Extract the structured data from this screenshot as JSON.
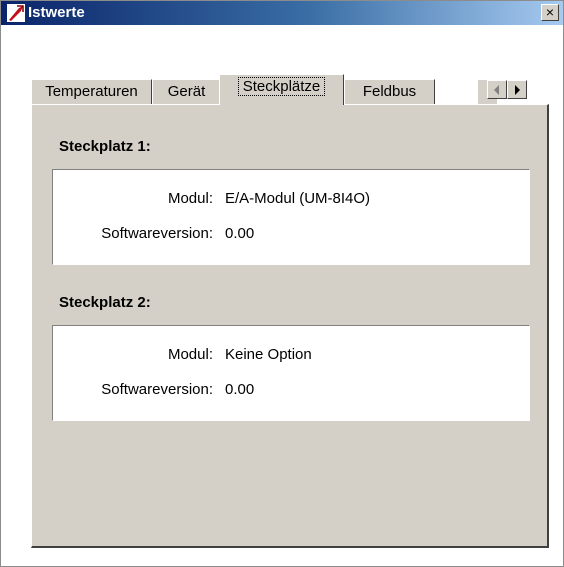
{
  "window": {
    "title": "Istwerte",
    "close_label": "×"
  },
  "tabs": [
    {
      "label": "Temperaturen",
      "active": false
    },
    {
      "label": "Gerät",
      "active": false
    },
    {
      "label": "Steckplätze",
      "active": true
    },
    {
      "label": "Feldbus",
      "active": false
    }
  ],
  "slots": [
    {
      "title": "Steckplatz 1:",
      "module_label": "Modul:",
      "module_value": "E/A-Modul (UM-8I4O)",
      "sw_label": "Softwareversion:",
      "sw_value": "0.00"
    },
    {
      "title": "Steckplatz 2:",
      "module_label": "Modul:",
      "module_value": "Keine Option",
      "sw_label": "Softwareversion:",
      "sw_value": "0.00"
    }
  ],
  "colors": {
    "titlebar_start": "#0a246a",
    "titlebar_end": "#a6caf0",
    "face": "#d4d0c8"
  }
}
